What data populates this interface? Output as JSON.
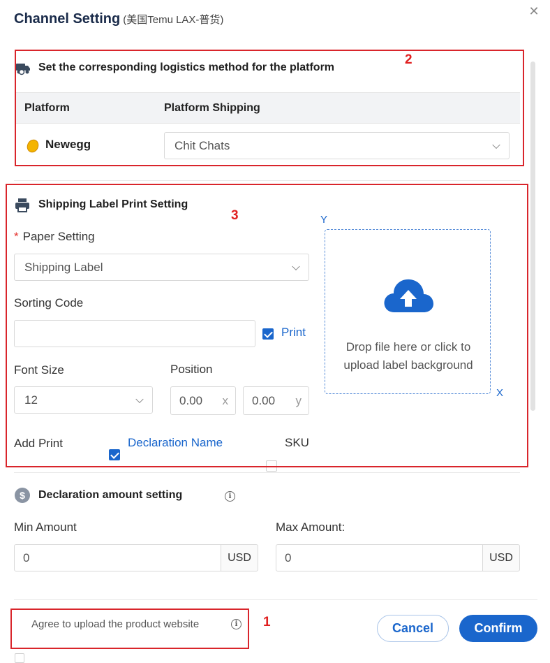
{
  "dialog": {
    "title": "Channel Setting",
    "subtitle": "(美国Temu LAX-普货)",
    "close_icon": "close-icon"
  },
  "logistics": {
    "section_title": "Set the corresponding logistics method for the platform",
    "columns": [
      "Platform",
      "Platform Shipping"
    ],
    "rows": [
      {
        "platform": "Newegg",
        "shipping": "Chit Chats"
      }
    ]
  },
  "label_print": {
    "section_title": "Shipping Label Print Setting",
    "paper_setting_label": "Paper Setting",
    "required_mark": "*",
    "paper_setting_value": "Shipping Label",
    "sorting_code_label": "Sorting Code",
    "sorting_code_value": "",
    "print_label": "Print",
    "print_checked": true,
    "font_size_label": "Font Size",
    "font_size_value": "12",
    "position_label": "Position",
    "position_x_value": "0.00",
    "position_x_suffix": "x",
    "position_y_value": "0.00",
    "position_y_suffix": "y",
    "add_print_label": "Add Print",
    "declaration_name_label": "Declaration Name",
    "declaration_name_checked": true,
    "sku_label": "SKU",
    "sku_checked": false,
    "upload_text_line1": "Drop file here or click to",
    "upload_text_line2": "upload label background",
    "axis_y": "Y",
    "axis_x": "X"
  },
  "declaration": {
    "section_title": "Declaration amount setting",
    "min_label": "Min Amount",
    "min_value": "0",
    "max_label": "Max Amount:",
    "max_value": "0",
    "currency": "USD"
  },
  "footer": {
    "agree_label": "Agree to upload the product website",
    "agree_checked": false,
    "cancel_label": "Cancel",
    "confirm_label": "Confirm"
  },
  "annotations": {
    "num_1": "1",
    "num_2": "2",
    "num_3": "3"
  },
  "colors": {
    "accent": "#1a66cc",
    "highlight_box": "#d9252b",
    "title": "#1a2b4a"
  }
}
